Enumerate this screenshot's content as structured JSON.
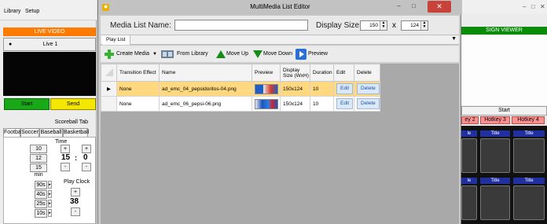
{
  "background_left": {
    "menu": [
      "Library",
      "Setup"
    ],
    "live_header": "LIVE VIDEO",
    "live_item": "Live 1",
    "start_label": "Start",
    "send_label": "Send",
    "scoreboard_title": "Scoreball Tab",
    "sport_tabs": [
      "Football",
      "Soccer",
      "Baseball",
      "Basketball"
    ],
    "time_label": "Time",
    "time_presets": [
      "10 min",
      "12 min",
      "15 min"
    ],
    "plus": "+",
    "minus": "-",
    "minutes": "15",
    "colon": ":",
    "seconds": "0",
    "play_clock_label": "Play Clock",
    "play_clock_presets": [
      "90s",
      "40s",
      "25s",
      "10s"
    ],
    "play_clock_value": "38"
  },
  "background_right": {
    "sign_viewer": "SIGN VIEWER",
    "start_label": "Start",
    "hotkeys": [
      "ey 2",
      "Hotkey 3",
      "Hotkey 4"
    ],
    "tile_titles": [
      "le",
      "Title",
      "Title",
      "le",
      "Title",
      "Title"
    ]
  },
  "dialog": {
    "title": "MultiMedia List Editor",
    "media_list_name_label": "Media List Name:",
    "media_list_name_value": "",
    "display_size_label": "Display Size:",
    "width_value": "150",
    "x_label": "x",
    "height_value": "124",
    "tab_label": "Play List",
    "toolbar": {
      "create_media": "Create Media",
      "from_library": "From Library",
      "move_up": "Move Up",
      "move_down": "Move Down",
      "preview": "Preview"
    },
    "grid": {
      "headers": [
        "Transition Effect",
        "Name",
        "Preview",
        "Display Size (WxH)",
        "Duration",
        "Edit",
        "Delete"
      ],
      "rows": [
        {
          "transition": "None",
          "name": "ad_emc_04_pepsidoritos-04.png",
          "size": "150x124",
          "duration": "10",
          "edit": "Edit",
          "delete": "Delete",
          "current_marker": "▶"
        },
        {
          "transition": "None",
          "name": "ad_emc_06_pepsi-06.png",
          "size": "150x124",
          "duration": "10",
          "edit": "Edit",
          "delete": "Delete",
          "current_marker": ""
        }
      ]
    }
  },
  "colors": {
    "live_header": "#ff7a00",
    "start_green": "#18a818",
    "send_yellow": "#f5e600",
    "selected_row": "#ffd880",
    "close_red": "#c9423a",
    "sign_viewer_green": "#0a8b0a"
  }
}
